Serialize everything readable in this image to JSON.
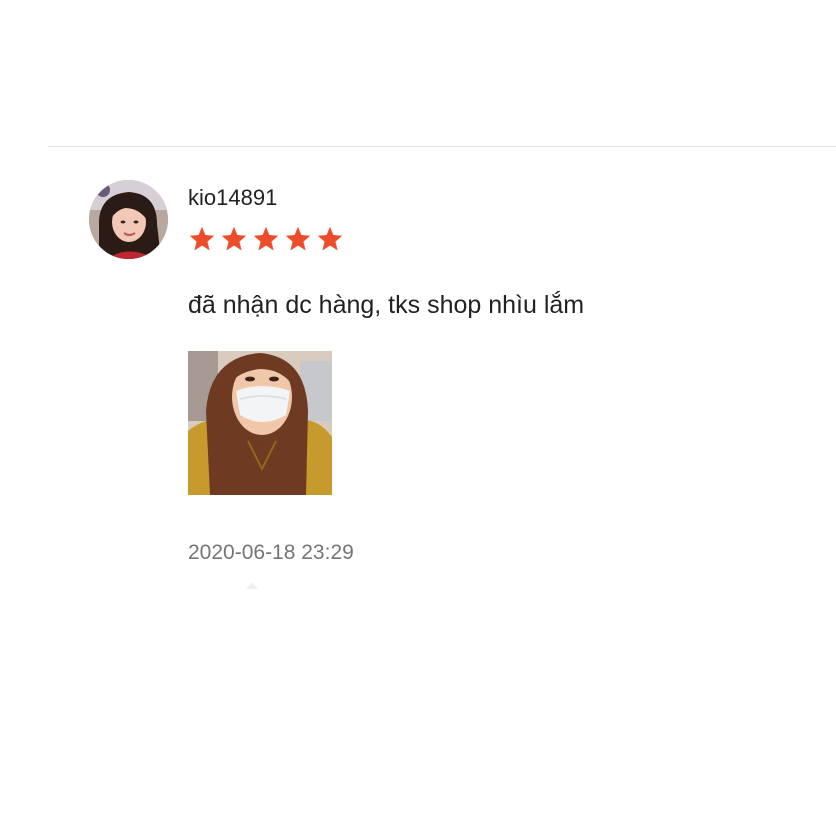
{
  "review": {
    "username": "kio14891",
    "rating": 5,
    "rating_max": 5,
    "star_color": "#ee4d2d",
    "comment": "đã nhận dc hàng, tks shop nhìu lắm",
    "photo_count": 1,
    "timestamp": "2020-06-18 23:29"
  }
}
